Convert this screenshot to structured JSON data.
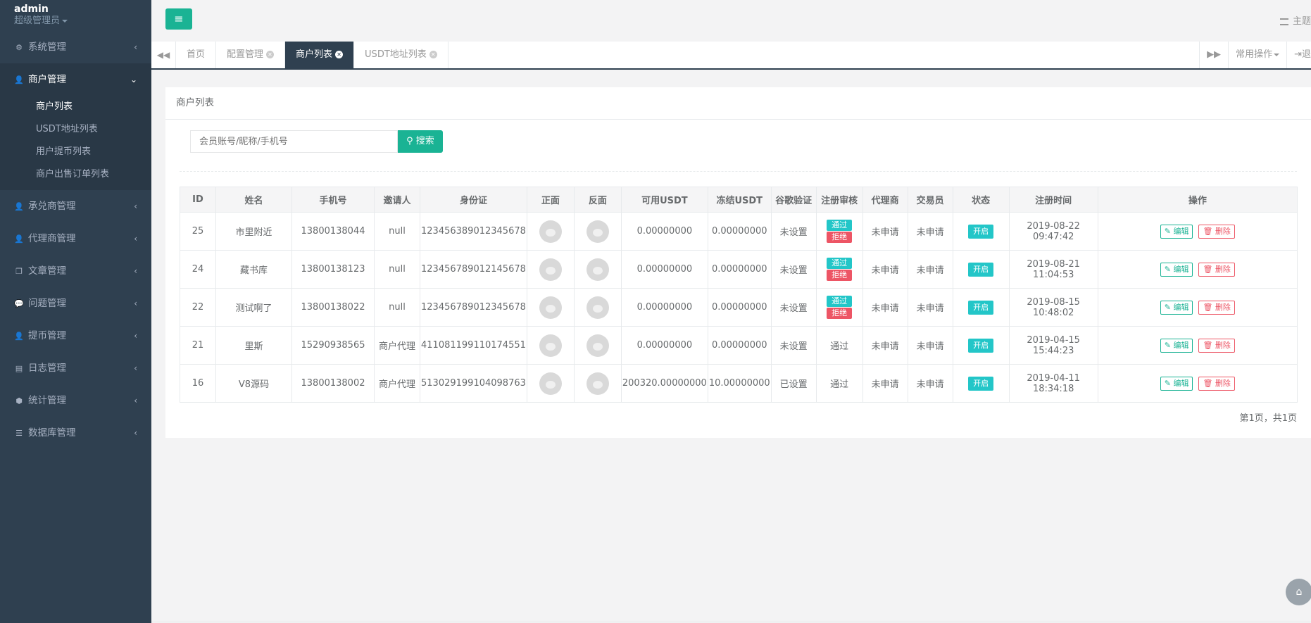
{
  "user": {
    "name": "admin",
    "role": "超级管理员"
  },
  "sidebar": {
    "items": [
      {
        "label": "系统管理",
        "icon": "gear-icon",
        "glyph": "⚙"
      },
      {
        "label": "商户管理",
        "icon": "user-icon",
        "glyph": "👤"
      },
      {
        "label": "承兑商管理",
        "icon": "user-icon",
        "glyph": "👤"
      },
      {
        "label": "代理商管理",
        "icon": "user-icon",
        "glyph": "👤"
      },
      {
        "label": "文章管理",
        "icon": "copy-icon",
        "glyph": "❐"
      },
      {
        "label": "问题管理",
        "icon": "comment-icon",
        "glyph": "💬"
      },
      {
        "label": "提币管理",
        "icon": "user-icon",
        "glyph": "👤"
      },
      {
        "label": "日志管理",
        "icon": "card-icon",
        "glyph": "▤"
      },
      {
        "label": "统计管理",
        "icon": "cube-icon",
        "glyph": "⬢"
      },
      {
        "label": "数据库管理",
        "icon": "database-icon",
        "glyph": "☰"
      }
    ],
    "sub": [
      "商户列表",
      "USDT地址列表",
      "用户提币列表",
      "商户出售订单列表"
    ]
  },
  "topbar": {
    "menu_glyph": "≡",
    "theme": "主题"
  },
  "tabs": [
    {
      "label": "首页"
    },
    {
      "label": "配置管理"
    },
    {
      "label": "商户列表"
    },
    {
      "label": "USDT地址列表"
    }
  ],
  "tabs_right": {
    "ops": "常用操作",
    "logout": "退"
  },
  "panel": {
    "title": "商户列表"
  },
  "search": {
    "placeholder": "会员账号/昵称/手机号",
    "button": "搜索"
  },
  "table": {
    "headers": [
      "ID",
      "姓名",
      "手机号",
      "邀请人",
      "身份证",
      "正面",
      "反面",
      "可用USDT",
      "冻结USDT",
      "谷歌验证",
      "注册审核",
      "代理商",
      "交易员",
      "状态",
      "注册时间",
      "操作"
    ],
    "rows": [
      {
        "id": "25",
        "name": "市里附近",
        "phone": "13800138044",
        "inviter": "null",
        "idcard": "123456389012345678",
        "usdt": "0.00000000",
        "frozen": "0.00000000",
        "google": "未设置",
        "review": "buttons",
        "agent": "未申请",
        "trader": "未申请",
        "status": "开启",
        "time": "2019-08-22 09:47:42"
      },
      {
        "id": "24",
        "name": "藏书库",
        "phone": "13800138123",
        "inviter": "null",
        "idcard": "123456789012145678",
        "usdt": "0.00000000",
        "frozen": "0.00000000",
        "google": "未设置",
        "review": "buttons",
        "agent": "未申请",
        "trader": "未申请",
        "status": "开启",
        "time": "2019-08-21 11:04:53"
      },
      {
        "id": "22",
        "name": "测试啊了",
        "phone": "13800138022",
        "inviter": "null",
        "idcard": "123456789012345678",
        "usdt": "0.00000000",
        "frozen": "0.00000000",
        "google": "未设置",
        "review": "buttons",
        "agent": "未申请",
        "trader": "未申请",
        "status": "开启",
        "time": "2019-08-15 10:48:02"
      },
      {
        "id": "21",
        "name": "里斯",
        "phone": "15290938565",
        "inviter": "商户代理",
        "idcard": "411081199110174551",
        "usdt": "0.00000000",
        "frozen": "0.00000000",
        "google": "未设置",
        "review": "通过",
        "agent": "未申请",
        "trader": "未申请",
        "status": "开启",
        "time": "2019-04-15 15:44:23"
      },
      {
        "id": "16",
        "name": "V8源码",
        "phone": "13800138002",
        "inviter": "商户代理",
        "idcard": "513029199104098763",
        "usdt": "200320.00000000",
        "frozen": "10.00000000",
        "google": "已设置",
        "review": "通过",
        "agent": "未申请",
        "trader": "未申请",
        "status": "开启",
        "time": "2019-04-11 18:34:18"
      }
    ],
    "approve": "通过",
    "reject": "拒绝",
    "edit": "编辑",
    "delete": "删除"
  },
  "pager": "第1页，共1页",
  "colors": {
    "accent": "#1ab394",
    "sidebar": "#2f4050",
    "info": "#23c6c8",
    "danger": "#ed5565"
  }
}
